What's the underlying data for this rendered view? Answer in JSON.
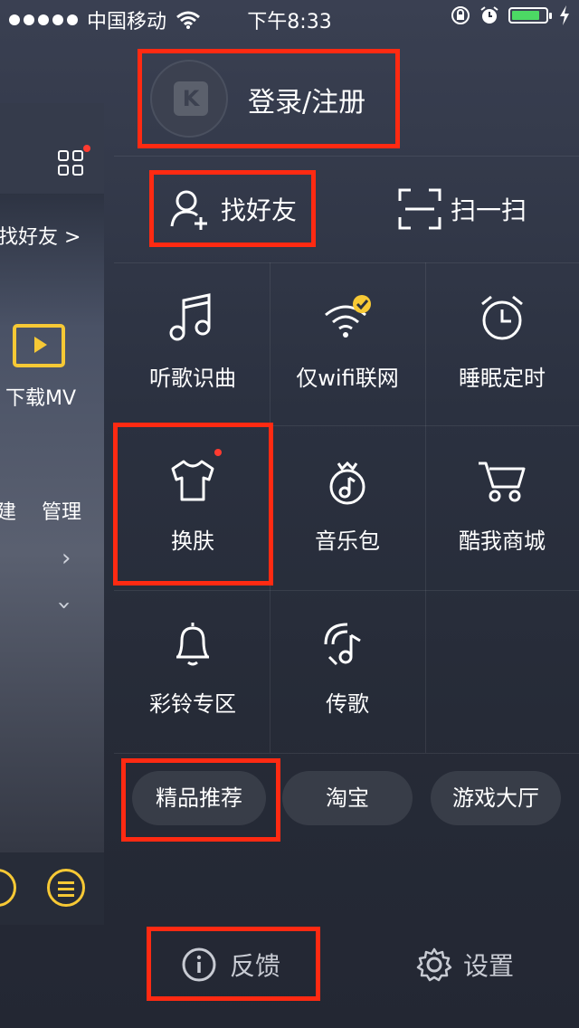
{
  "status_bar": {
    "carrier": "中国移动",
    "time": "下午8:33",
    "battery_color": "#4cd964",
    "icons": [
      "signal-dots",
      "wifi-icon",
      "orientation-lock-icon",
      "alarm-icon",
      "battery-icon",
      "charging-icon"
    ]
  },
  "left_panel": {
    "find_friends": "找好友 >",
    "download_mv": "下载MV",
    "new_label": "建",
    "manage_label": "管理"
  },
  "menu": {
    "login_label": "登录/注册",
    "find_friends_label": "找好友",
    "scan_label": "扫一扫",
    "grid": [
      {
        "label": "听歌识曲",
        "icon": "music-note-icon"
      },
      {
        "label": "仅wifi联网",
        "icon": "wifi-check-icon"
      },
      {
        "label": "睡眠定时",
        "icon": "alarm-clock-icon"
      },
      {
        "label": "换肤",
        "icon": "tshirt-icon"
      },
      {
        "label": "音乐包",
        "icon": "music-bag-icon"
      },
      {
        "label": "酷我商城",
        "icon": "cart-icon"
      },
      {
        "label": "彩铃专区",
        "icon": "bell-icon"
      },
      {
        "label": "传歌",
        "icon": "share-song-icon"
      }
    ],
    "pills": [
      "精品推荐",
      "淘宝",
      "游戏大厅"
    ],
    "feedback_label": "反馈",
    "settings_label": "设置"
  },
  "colors": {
    "highlight": "#ff2a12",
    "accent_yellow": "#f7c935",
    "badge_red": "#ff3b30"
  }
}
